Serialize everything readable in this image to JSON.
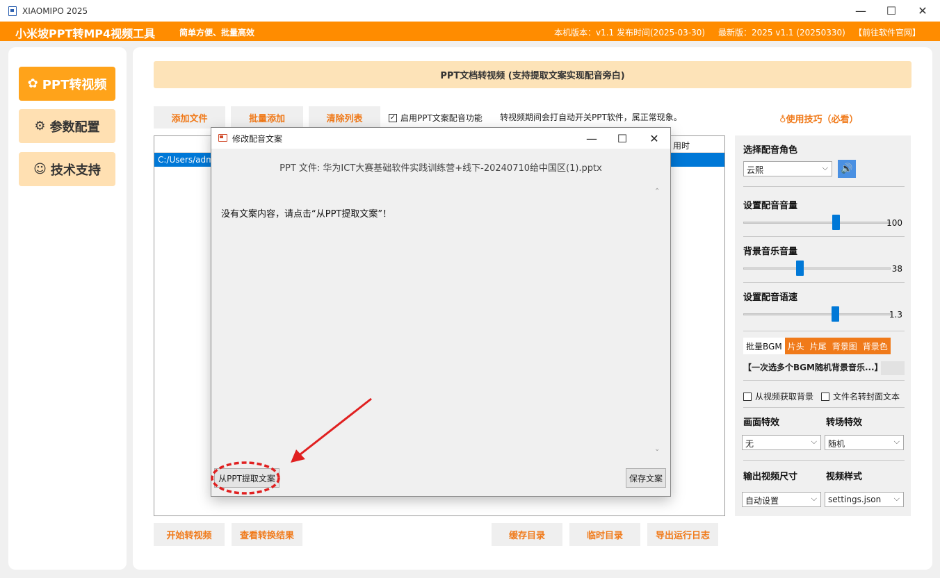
{
  "window": {
    "title": "XIAOMIPO 2025",
    "controls": {
      "minimize": "—",
      "maximize": "☐",
      "close": "✕"
    }
  },
  "header": {
    "brand": "小米坡PPT转MP4视频工具",
    "slogan": "简单方便、批量高效",
    "local_version": "本机版本：v1.1  发布时间(2025-03-30)",
    "latest_version": "最新版：2025 v1.1 (20250330)",
    "website_link": "【前往软件官网】"
  },
  "sidebar": {
    "items": [
      {
        "label": "PPT转视频",
        "icon": "palette-icon",
        "active": true
      },
      {
        "label": "参数配置",
        "icon": "gear-icon",
        "active": false
      },
      {
        "label": "技术支持",
        "icon": "user-support-icon",
        "active": false
      }
    ]
  },
  "main": {
    "banner": "PPT文档转视频 (支持提取文案实现配音旁白)",
    "toolbar": {
      "add_file": "添加文件",
      "batch_add": "批量添加",
      "clear_list": "清除列表",
      "voice_checkbox": "启用PPT文案配音功能",
      "notice": "转视频期间会打自动开关PPT软件，属正常现象。",
      "tips": "使用技巧（必看）"
    },
    "file_list": {
      "column_time": "用时",
      "row_path": "C:/Users/adm"
    },
    "bottom_buttons": {
      "start": "开始转视频",
      "view_results": "查看转换结果",
      "cache_dir": "缓存目录",
      "temp_dir": "临时目录",
      "export_log": "导出运行日志"
    }
  },
  "settings": {
    "voice_role_label": "选择配音角色",
    "voice_role_value": "云熙",
    "voice_volume_label": "设置配音音量",
    "voice_volume_value": "100",
    "bg_music_label": "背景音乐音量",
    "bg_music_value": "38",
    "speed_label": "设置配音语速",
    "speed_value": "1.3",
    "tabs": [
      "批量BGM",
      "片头",
      "片尾",
      "背景图",
      "背景色"
    ],
    "bgm_text": "【一次选多个BGM随机背景音乐...】",
    "cb_video_bg": "从视频获取背景",
    "cb_filename_cover": "文件名转封面文本",
    "effect_label": "画面特效",
    "effect_value": "无",
    "transition_label": "转场特效",
    "transition_value": "随机",
    "output_size_label": "输出视频尺寸",
    "output_size_value": "自动设置",
    "video_style_label": "视频样式",
    "video_style_value": "settings.json"
  },
  "dialog": {
    "title": "修改配音文案",
    "file_info": "PPT 文件: 华为ICT大赛基础软件实践训练营+线下-20240710给中国区(1).pptx",
    "content": "没有文案内容，请点击“从PPT提取文案”！",
    "extract_button": "从PPT提取文案",
    "save_button": "保存文案"
  },
  "colors": {
    "brand_orange": "#ff8c00",
    "accent_text": "#f07a1a",
    "selection_blue": "#0078d7",
    "annotation_red": "#e02020"
  }
}
